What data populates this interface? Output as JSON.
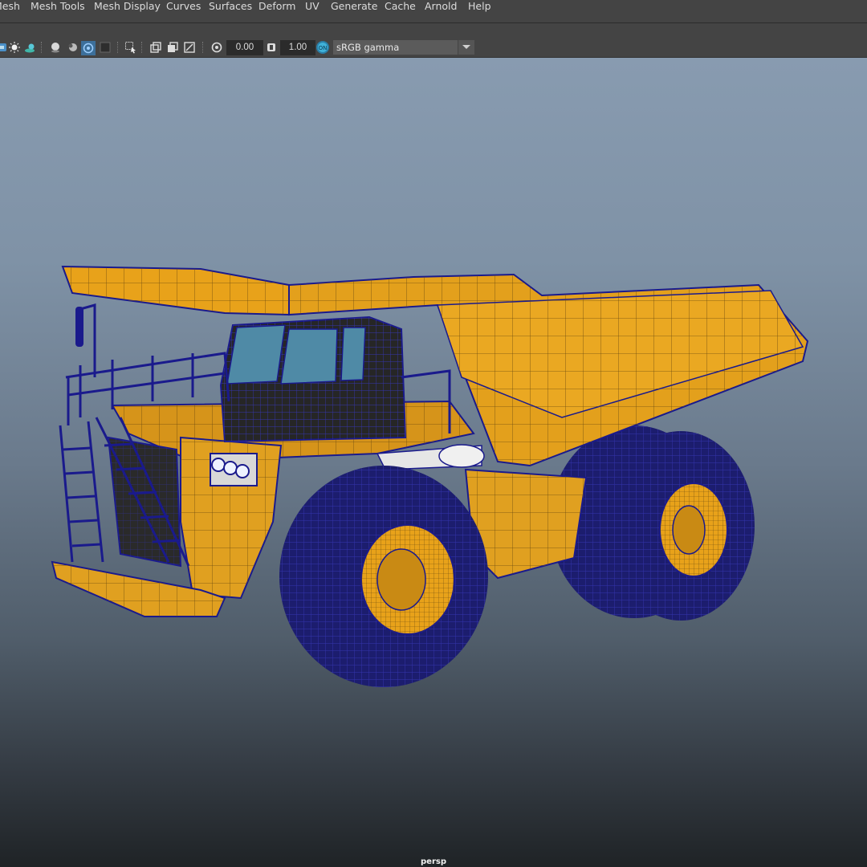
{
  "menu": {
    "items": [
      "Mesh",
      "Mesh Tools",
      "Mesh Display",
      "Curves",
      "Surfaces",
      "Deform",
      "UV",
      "Generate",
      "Cache",
      "Arnold",
      "Help"
    ]
  },
  "toolbar": {
    "exposure_value": "0.00",
    "gamma_value": "1.00",
    "color_space": "sRGB gamma",
    "icons": [
      "display-icon",
      "light-icon",
      "shadow-icon",
      "sphere-icon",
      "material-icon",
      "isolate-icon",
      "grid-icon",
      "select-icon",
      "camera-icon",
      "frame-icon",
      "resolution-icon",
      "exposure-icon",
      "gamma-icon",
      "color-management-icon"
    ]
  },
  "viewport": {
    "camera_label": "persp",
    "model_colors": {
      "body": "#e8a21a",
      "wire": "#1a1a8c",
      "tire": "#1c1d6e",
      "glass": "#4f8aa6"
    }
  }
}
